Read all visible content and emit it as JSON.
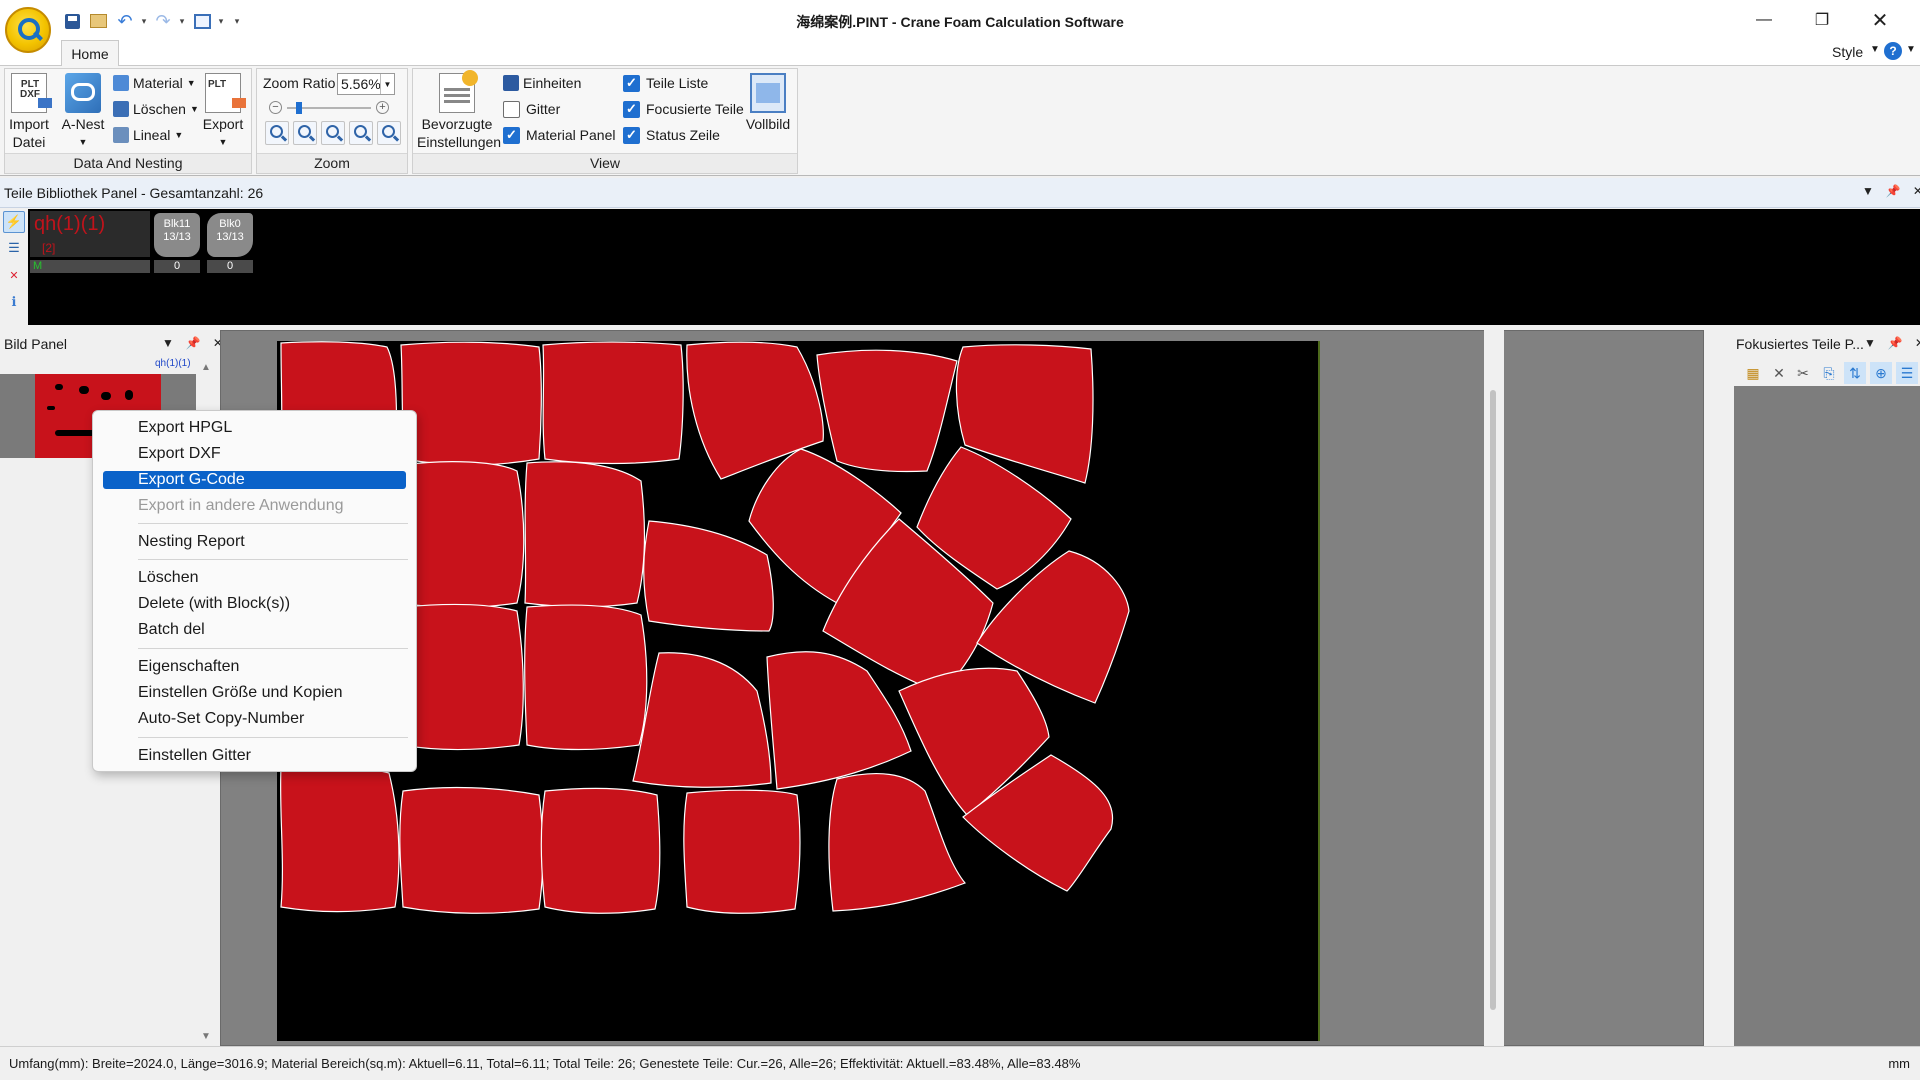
{
  "window": {
    "title": "海绵案例.PINT - Crane Foam Calculation Software",
    "minimize_glyph": "—",
    "maximize_glyph": "❐",
    "close_glyph": "✕"
  },
  "quick_access": {
    "icons": [
      "save-icon",
      "open-icon",
      "undo-icon",
      "redo-icon",
      "print-icon"
    ],
    "more_glyph": "▾"
  },
  "ribbon": {
    "tabs": [
      {
        "label": "Home",
        "active": true
      }
    ],
    "style_label": "Style",
    "help_glyph": "?",
    "groups": {
      "data": {
        "label": "Data And Nesting",
        "import_line1": "Import",
        "import_line2": "Datei",
        "anest_label": "A-Nest",
        "material_label": "Material",
        "loeschen_label": "Löschen",
        "lineal_label": "Lineal",
        "export_label": "Export",
        "import_icon_text": "PLT DXF",
        "export_icon_text": "PLT"
      },
      "zoom": {
        "label": "Zoom",
        "ratio_label": "Zoom Ratio",
        "ratio_value": "5.56%",
        "slider_level_percent": 12
      },
      "view": {
        "label": "View",
        "pref_line1": "Bevorzugte",
        "pref_line2": "Einstellungen",
        "einheiten_label": "Einheiten",
        "gitter_label": "Gitter",
        "material_panel_label": "Material Panel",
        "teile_liste_label": "Teile Liste",
        "focusierte_teile_label": "Focusierte Teile",
        "status_zeile_label": "Status Zeile",
        "vollbild_label": "Vollbild",
        "checkboxes": {
          "gitter": false,
          "material_panel": true,
          "teile_liste": true,
          "focusierte_teile": true,
          "status_zeile": true
        }
      }
    }
  },
  "library": {
    "title": "Teile Bibliothek Panel - Gesamtanzahl: 26",
    "part": {
      "name": "qh(1)(1)",
      "count": "[2]",
      "material": "M"
    },
    "blocks": [
      {
        "name": "Blk11",
        "ratio": "13/13",
        "count": "0"
      },
      {
        "name": "Blk0",
        "ratio": "13/13",
        "count": "0"
      }
    ]
  },
  "bild_panel": {
    "title": "Bild Panel",
    "thumb_label": "qh(1)(1)"
  },
  "focus_panel": {
    "title": "Fokusiertes Teile P..."
  },
  "context_menu": {
    "items": [
      {
        "label": "Export HPGL",
        "state": "normal"
      },
      {
        "label": "Export DXF",
        "state": "normal"
      },
      {
        "label": "Export G-Code",
        "state": "selected"
      },
      {
        "label": "Export in andere Anwendung",
        "state": "disabled"
      },
      {
        "label": "Nesting Report",
        "state": "normal"
      },
      {
        "label": "Löschen",
        "state": "normal"
      },
      {
        "label": "Delete (with Block(s))",
        "state": "normal"
      },
      {
        "label": "Batch del",
        "state": "normal"
      },
      {
        "label": "Eigenschaften",
        "state": "normal"
      },
      {
        "label": "Einstellen Größe und Kopien",
        "state": "normal"
      },
      {
        "label": "Auto-Set Copy-Number",
        "state": "normal"
      },
      {
        "label": "Einstellen Gitter",
        "state": "normal"
      }
    ]
  },
  "canvas": {
    "sheet_color": "#000000",
    "part_color": "#c8121b",
    "background_color": "#818181"
  },
  "status": {
    "text": "Umfang(mm): Breite=2024.0, Länge=3016.9; Material Bereich(sq.m): Aktuell=6.11, Total=6.11; Total Teile: 26; Genestete Teile: Cur.=26, Alle=26; Effektivität: Aktuell.=83.48%, Alle=83.48%",
    "unit": "mm"
  },
  "colors": {
    "accent": "#0a62c9",
    "checkbox_on": "#1f6fd0",
    "part_red": "#c8121b"
  }
}
